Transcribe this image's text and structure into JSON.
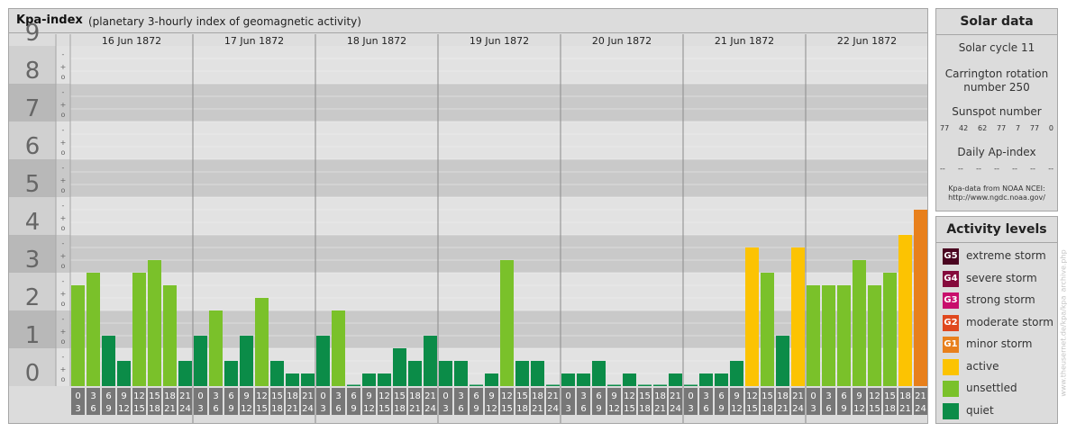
{
  "main": {
    "title": "Kpa-index",
    "subtitle": "(planetary 3-hourly index of geomagnetic activity)"
  },
  "colors": {
    "quiet": "#0b8c48",
    "unsettled": "#7ac12a",
    "active": "#fcc302",
    "G1": "#e8801c",
    "G2": "#e0481e",
    "G3": "#c80e6c",
    "G4": "#850a3c",
    "G5": "#4a0520"
  },
  "chart_data": {
    "type": "bar",
    "ylim": [
      0,
      9
    ],
    "y_ticks": [
      "0",
      "1",
      "2",
      "3",
      "4",
      "5",
      "6",
      "7",
      "8",
      "9"
    ],
    "sub_ticks": [
      "o",
      "+",
      "-"
    ],
    "days": [
      "16 Jun 1872",
      "17 Jun 1872",
      "18 Jun 1872",
      "19 Jun 1872",
      "20 Jun 1872",
      "21 Jun 1872",
      "22 Jun 1872"
    ],
    "interval_labels": [
      [
        "0",
        "3"
      ],
      [
        "3",
        "6"
      ],
      [
        "6",
        "9"
      ],
      [
        "9",
        "12"
      ],
      [
        "12",
        "15"
      ],
      [
        "15",
        "18"
      ],
      [
        "18",
        "21"
      ],
      [
        "21",
        "24"
      ]
    ],
    "values": [
      [
        2.667,
        3.0,
        1.333,
        0.667,
        3.0,
        3.333,
        2.667,
        0.667
      ],
      [
        1.333,
        2.0,
        0.667,
        1.333,
        2.333,
        0.667,
        0.333,
        0.333
      ],
      [
        1.333,
        2.0,
        0.0,
        0.333,
        0.333,
        1.0,
        0.667,
        1.333
      ],
      [
        0.667,
        0.667,
        0.0,
        0.333,
        3.333,
        0.667,
        0.667,
        0.0
      ],
      [
        0.333,
        0.333,
        0.667,
        0.0,
        0.333,
        0.0,
        0.0,
        0.333
      ],
      [
        0.0,
        0.333,
        0.333,
        0.667,
        3.667,
        3.0,
        1.333,
        3.667
      ],
      [
        2.667,
        2.667,
        2.667,
        3.333,
        2.667,
        3.0,
        4.0,
        4.667
      ]
    ]
  },
  "solar": {
    "title": "Solar data",
    "cycle": "Solar cycle 11",
    "carrington_1": "Carrington rotation",
    "carrington_2": "number 250",
    "sunspot_label": "Sunspot number",
    "sunspot_values": [
      "77",
      "42",
      "62",
      "77",
      "7",
      "77",
      "0"
    ],
    "ap_label": "Daily Ap-index",
    "ap_values": [
      "--",
      "--",
      "--",
      "--",
      "--",
      "--",
      "--"
    ],
    "credit_1": "Kpa-data from NOAA NCEI:",
    "credit_2": "http://www.ngdc.noaa.gov/"
  },
  "levels": {
    "title": "Activity levels",
    "items": [
      {
        "badge": "G5",
        "label": "extreme storm",
        "color": "#4a0520"
      },
      {
        "badge": "G4",
        "label": "severe storm",
        "color": "#850a3c"
      },
      {
        "badge": "G3",
        "label": "strong storm",
        "color": "#c80e6c"
      },
      {
        "badge": "G2",
        "label": "moderate storm",
        "color": "#e0481e"
      },
      {
        "badge": "G1",
        "label": "minor storm",
        "color": "#e8801c"
      },
      {
        "badge": "",
        "label": "active",
        "color": "#fcc302"
      },
      {
        "badge": "",
        "label": "unsettled",
        "color": "#7ac12a"
      },
      {
        "badge": "",
        "label": "quiet",
        "color": "#0b8c48"
      }
    ]
  },
  "credit_vertical": "www.theusernet.de/kpa/kpa_archive.php"
}
